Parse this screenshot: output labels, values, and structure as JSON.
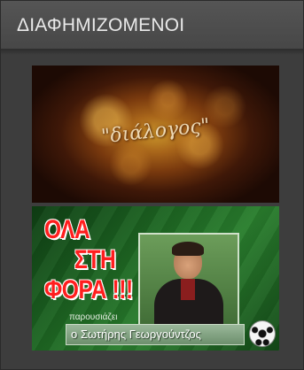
{
  "widget": {
    "title": "ΔΙΑΦΗΜΙΖΟΜΕΝΟΙ",
    "banners": [
      {
        "id": "banner-dialogos",
        "logo_text": "\"διάλογος\""
      },
      {
        "id": "banner-ola-sti-fora",
        "headline": [
          "ΟΛΑ",
          "ΣΤΗ",
          "ΦΟΡΑ !!!"
        ],
        "presenter_label": "παρουσιάζει",
        "presenter_name": "ο Σωτήρης Γεωργούντζος"
      }
    ]
  }
}
